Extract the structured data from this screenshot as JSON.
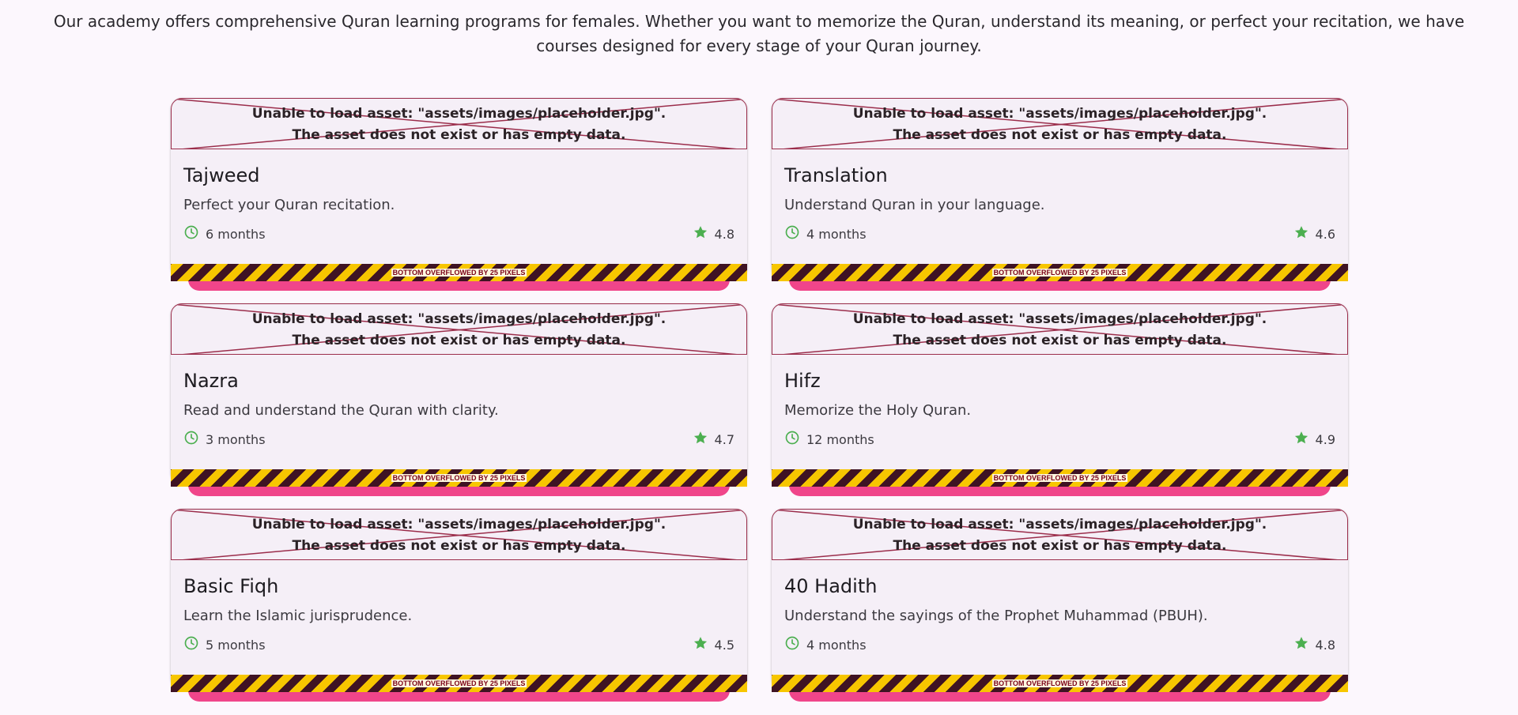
{
  "intro": "Our academy offers comprehensive Quran learning programs for females. Whether you want to memorize the Quran, understand its meaning, or perfect your recitation, we have courses designed for every stage of your Quran journey.",
  "image_error": {
    "line1": "Unable to load asset: \"assets/images/placeholder.jpg\".",
    "line2": "The asset does not exist or has empty data."
  },
  "overflow_label": "BOTTOM OVERFLOWED BY 25 PIXELS",
  "colors": {
    "accent_pink": "#f0458a",
    "icon_green": "#4caf50",
    "error_border": "#9b2d4b"
  },
  "courses": [
    {
      "title": "Tajweed",
      "description": "Perfect your Quran recitation.",
      "duration": "6 months",
      "rating": "4.8"
    },
    {
      "title": "Translation",
      "description": "Understand Quran in your language.",
      "duration": "4 months",
      "rating": "4.6"
    },
    {
      "title": "Nazra",
      "description": "Read and understand the Quran with clarity.",
      "duration": "3 months",
      "rating": "4.7"
    },
    {
      "title": "Hifz",
      "description": "Memorize the Holy Quran.",
      "duration": "12 months",
      "rating": "4.9"
    },
    {
      "title": "Basic Fiqh",
      "description": "Learn the Islamic jurisprudence.",
      "duration": "5 months",
      "rating": "4.5"
    },
    {
      "title": " 40 Hadith",
      "description": "Understand the sayings of the Prophet Muhammad (PBUH).",
      "duration": "4 months",
      "rating": "4.8"
    }
  ]
}
